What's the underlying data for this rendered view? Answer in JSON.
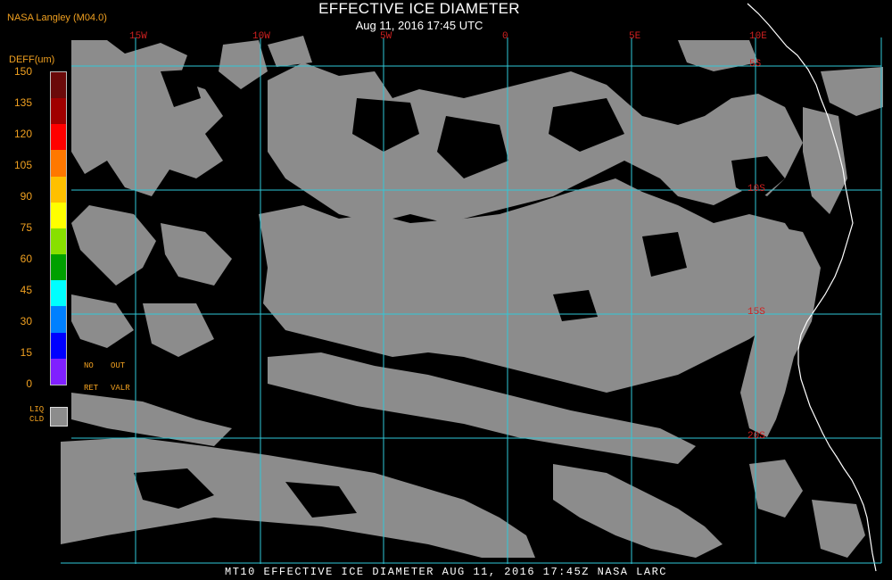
{
  "producer": "NASA Langley (M04.0)",
  "title": "EFFECTIVE ICE DIAMETER",
  "subtitle": "Aug 11, 2016 17:45 UTC",
  "footer": "MT10  EFFECTIVE ICE DIAMETER   AUG 11, 2016 17:45Z   NASA LARC",
  "scale": {
    "title": "DEFF(um)",
    "ticks": [
      "150",
      "135",
      "120",
      "105",
      "90",
      "75",
      "60",
      "45",
      "30",
      "15",
      "0"
    ],
    "colors": [
      "#6a0a0a",
      "#a00000",
      "#ff0000",
      "#ff7800",
      "#ffc000",
      "#ffff00",
      "#88e000",
      "#00a000",
      "#00ffff",
      "#0080ff",
      "#0000ff",
      "#8020ff"
    ],
    "no_ret_line1": "NO",
    "no_ret_line2": "RET",
    "out_valr_line1": "OUT",
    "out_valr_line2": "VALR",
    "liq_line1": "LIQ",
    "liq_line2": "CLD",
    "liq_color": "#8c8c8c"
  },
  "grid": {
    "longitudes": [
      "15W",
      "10W",
      "5W",
      "0",
      "5E",
      "10E"
    ],
    "latitudes": [
      "5S",
      "10S",
      "15S",
      "20S"
    ],
    "line_color": "#30c8d8"
  },
  "map": {
    "cloud_color": "#8c8c8c",
    "coast_color": "#ffffff",
    "background": "#000000"
  }
}
